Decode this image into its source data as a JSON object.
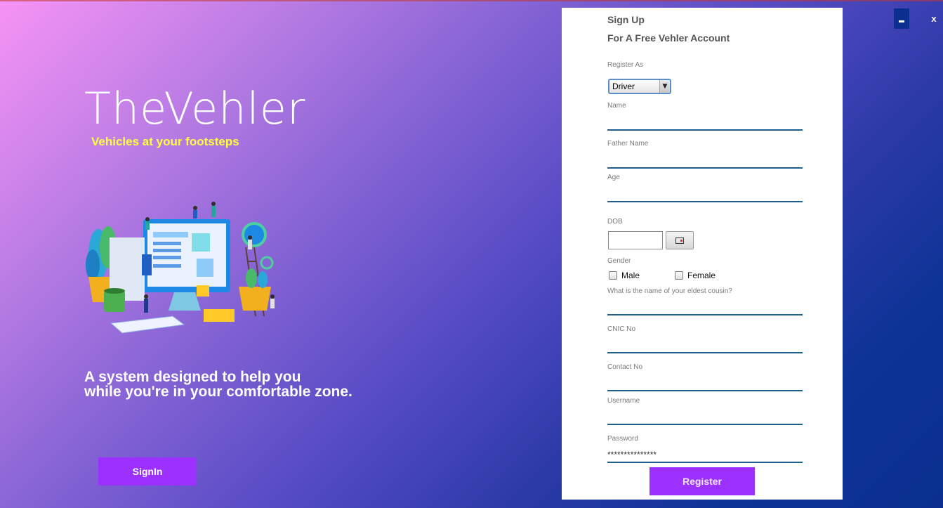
{
  "window": {
    "minimize_label": "-",
    "close_label": "x"
  },
  "brand": {
    "title": "TheVehler",
    "tagline": "Vehicles at your footsteps",
    "description_line1": "A system designed to help you",
    "description_line2": "while you're in your comfortable zone.",
    "signin_label": "SignIn"
  },
  "form": {
    "title": "Sign Up",
    "subtitle": "For A Free Vehler Account",
    "register_as_label": "Register As",
    "register_as_value": "Driver",
    "name_label": "Name",
    "name_value": "",
    "father_name_label": "Father Name",
    "father_name_value": "",
    "age_label": "Age",
    "age_value": "",
    "dob_label": "DOB",
    "dob_value": "",
    "gender_label": "Gender",
    "gender_male": "Male",
    "gender_female": "Female",
    "security_question_label": "What is the name of your eldest cousin?",
    "security_answer_value": "",
    "cnic_label": "CNIC No",
    "cnic_value": "",
    "contact_label": "Contact No",
    "contact_value": "",
    "username_label": "Username",
    "username_value": "",
    "password_label": "Password",
    "password_value": "***************",
    "register_label": "Register"
  },
  "colors": {
    "accent": "#9b30ff",
    "tagline": "#ffff3c",
    "input_underline": "#1f5f8b",
    "dark_blue": "#0a2f8f"
  }
}
